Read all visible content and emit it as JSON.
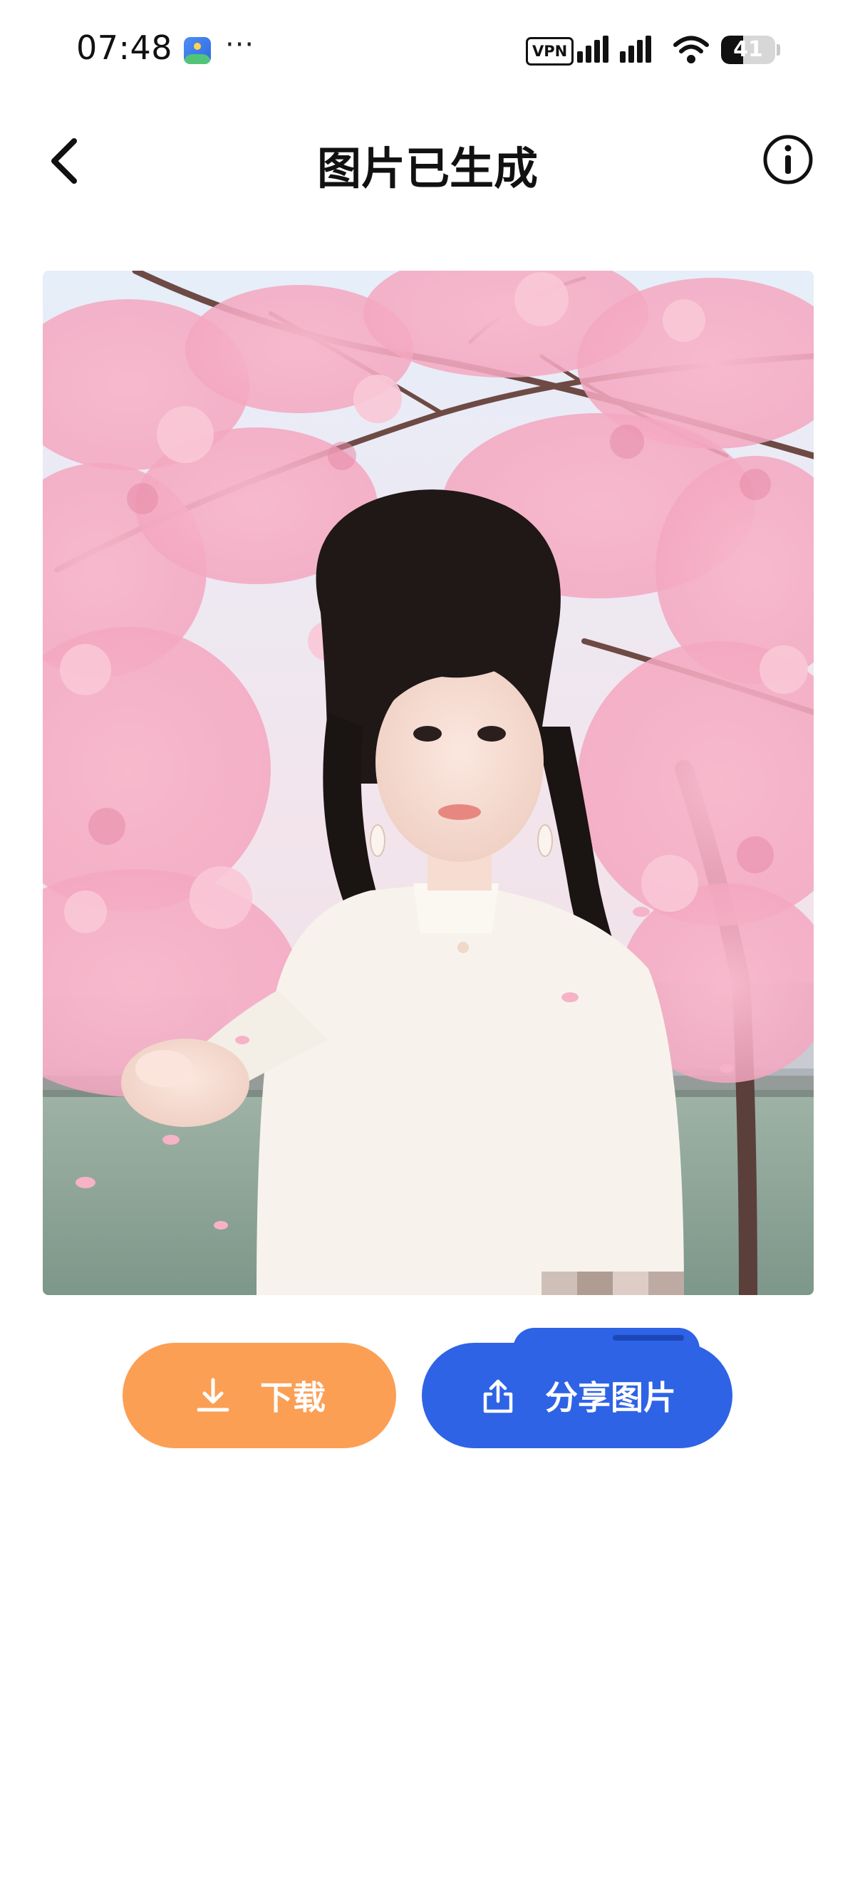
{
  "status_bar": {
    "time": "07:48",
    "more": "···",
    "vpn": "VPN",
    "battery_level": "41",
    "battery_fraction": 0.41,
    "icons": [
      "app-notification-icon",
      "signal-icon",
      "wifi-icon",
      "battery-icon"
    ]
  },
  "header": {
    "title": "图片已生成",
    "back_icon": "chevron-left-icon",
    "info_icon": "info-circle-icon"
  },
  "actions": {
    "download_label": "下载",
    "share_label": "分享图片",
    "download_icon": "download-icon",
    "share_icon": "share-icon"
  },
  "colors": {
    "download_button": "#fb9f55",
    "share_button": "#2e63e6",
    "blossom": "#f4a7c0",
    "sky": "#dfeaf7"
  }
}
